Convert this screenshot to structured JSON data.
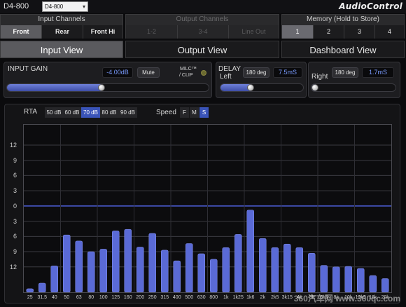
{
  "header": {
    "device_title": "D4-800",
    "device_select": "D4-800",
    "brand": "AudioControl"
  },
  "input_channels": {
    "title": "Input Channels",
    "tabs": [
      "Front",
      "Rear",
      "Front Hi"
    ],
    "active": 0
  },
  "output_channels": {
    "title": "Output Channels",
    "tabs": [
      "1-2",
      "3-4",
      "Line Out"
    ]
  },
  "memory": {
    "title": "Memory (Hold to Store)",
    "slots": [
      "1",
      "2",
      "3",
      "4"
    ],
    "active": 0
  },
  "views": {
    "tabs": [
      "Input View",
      "Output View",
      "Dashboard View"
    ],
    "active": 0
  },
  "input_gain": {
    "label": "INPUT GAIN",
    "value": "-4.00dB",
    "mute_label": "Mute",
    "milc_label": "MILC™",
    "clip_label": "/ CLIP",
    "slider_level": 0.47
  },
  "delay": {
    "label": "DELAY",
    "left_label": "Left",
    "right_label": "Right",
    "left_phase": "180 deg",
    "left_value": "7.5mS",
    "right_phase": "180 deg",
    "right_value": "1.7mS",
    "left_level": 0.37,
    "right_level": 0.05
  },
  "rta": {
    "label": "RTA",
    "ranges": [
      "50 dB",
      "60 dB",
      "70 dB",
      "80 dB",
      "90 dB"
    ],
    "active_range": 2,
    "speed_label": "Speed",
    "speeds": [
      "F",
      "M",
      "S"
    ],
    "active_speed": 2
  },
  "watermark": "360汽车网 www.360qc.com",
  "chart_data": {
    "type": "bar",
    "ylabels": [
      "12",
      "9",
      "6",
      "3",
      "0",
      "3",
      "6",
      "9",
      "12"
    ],
    "categories": [
      "25",
      "31.5",
      "40",
      "50",
      "63",
      "80",
      "100",
      "125",
      "160",
      "200",
      "250",
      "315",
      "400",
      "500",
      "630",
      "800",
      "1k",
      "1k25",
      "1k6",
      "2k",
      "2k5",
      "3k15",
      "4k",
      "5k",
      "6k3",
      "8k",
      "10k",
      "12k5",
      "16k",
      "20k"
    ],
    "values": [
      -16.3,
      -15.2,
      -11.8,
      -5.7,
      -6.9,
      -9.0,
      -8.5,
      -4.9,
      -4.6,
      -8.1,
      -5.4,
      -8.7,
      -10.8,
      -7.4,
      -9.4,
      -10.5,
      -8.2,
      -5.6,
      -0.8,
      -6.4,
      -8.2,
      -7.5,
      -8.2,
      -9.3,
      -11.7,
      -12.0,
      -11.9,
      -12.3,
      -13.7,
      -14.3
    ],
    "ylim": [
      -17,
      16
    ],
    "bar_color": "#5a6ad6",
    "zero_line_color": "#4c5ed8"
  }
}
